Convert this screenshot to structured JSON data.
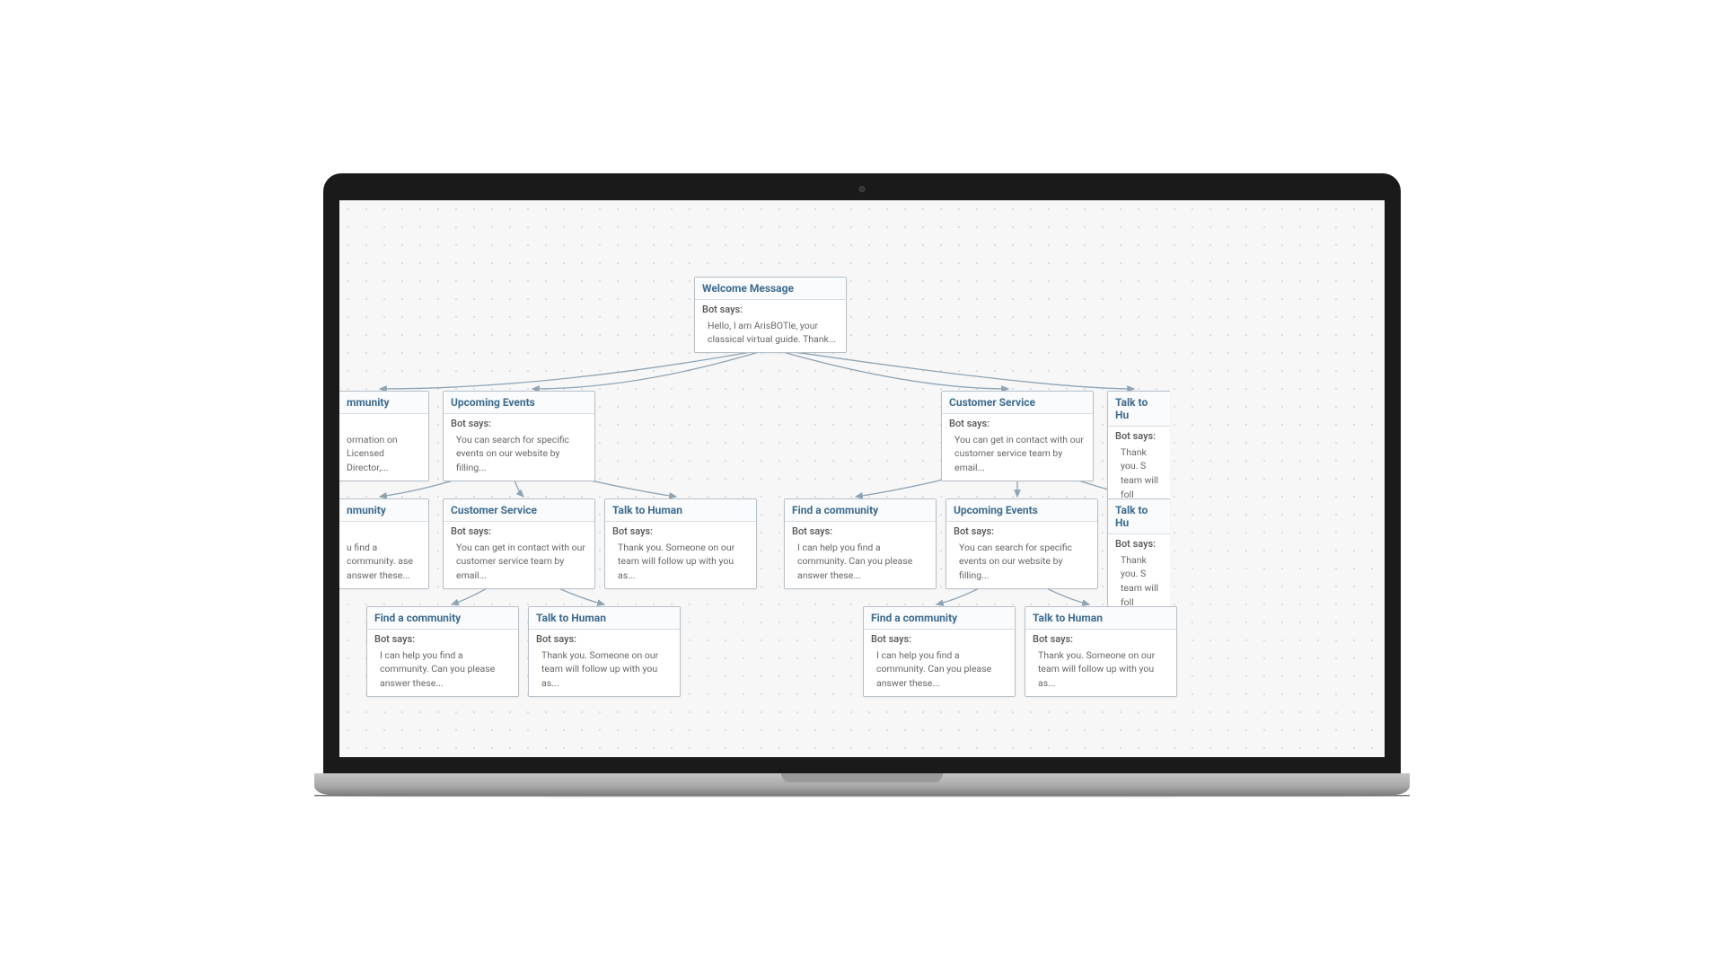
{
  "bot_says_label": "Bot says:",
  "nodes": {
    "welcome": {
      "title": "Welcome Message",
      "text": "Hello, I am ArisBOTle, your classical virtual guide.  Thank..."
    },
    "r2_community_left": {
      "title": "mmunity",
      "text": "ormation on Licensed Director,..."
    },
    "r2_upcoming": {
      "title": "Upcoming Events",
      "text": "You can search for specific events on our website by filling..."
    },
    "r2_cs": {
      "title": "Customer Service",
      "text": "You can get in contact with our customer service team by email..."
    },
    "r2_talk_right": {
      "title": "Talk to Hu",
      "text": "Thank you. S team will foll"
    },
    "r3_nmunity": {
      "title": "nmunity",
      "text": "u find a community. ase answer these..."
    },
    "r3_cs": {
      "title": "Customer Service",
      "text": "You can get in contact with our customer service team by email..."
    },
    "r3_talk": {
      "title": "Talk to Human",
      "text": "Thank you. Someone on our team will follow up with you as..."
    },
    "r3_find": {
      "title": "Find a community",
      "text": "I can help you find a community. Can you please answer these..."
    },
    "r3_upcoming": {
      "title": "Upcoming Events",
      "text": "You can search for specific events on our website by filling..."
    },
    "r3_talk_right": {
      "title": "Talk to Hu",
      "text": "Thank you. S team will foll"
    },
    "r4_find_a": {
      "title": "Find a community",
      "text": "I can help you find a community. Can you please answer these..."
    },
    "r4_talk_a": {
      "title": "Talk to Human",
      "text": "Thank you. Someone on our team will follow up with you as..."
    },
    "r4_find_b": {
      "title": "Find a community",
      "text": "I can help you find a community. Can you please answer these..."
    },
    "r4_talk_b": {
      "title": "Talk to Human",
      "text": "Thank you. Someone on our team will follow up with you as..."
    }
  }
}
